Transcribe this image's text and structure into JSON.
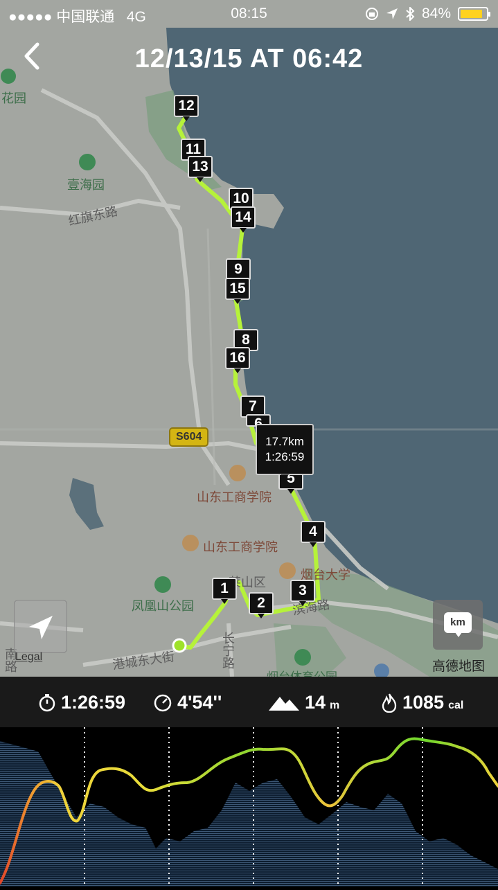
{
  "status_bar": {
    "carrier": "●●●●● 中国联通",
    "network": "4G",
    "time": "08:15",
    "battery": "84%",
    "battery_level": 0.84
  },
  "header": {
    "title": "12/13/15 AT 06:42"
  },
  "map": {
    "tooltip": {
      "distance": "17.7km",
      "time": "1:26:59"
    },
    "markers": [
      "12",
      "11",
      "13",
      "10",
      "14",
      "9",
      "15",
      "8",
      "16",
      "7",
      "6",
      "5",
      "4",
      "3",
      "2",
      "1"
    ],
    "labels": {
      "huayuan": "花园",
      "yihaiyuan": "壹海园",
      "hongqi_road": "红旗东路",
      "s604": "S604",
      "sdtbu_1": "山东工商学院",
      "sdtbu_2": "山东工商学院",
      "ytu": "烟台大学",
      "fenghuang_park": "凤凰山公园",
      "gangcheng_st": "港城东大街",
      "binhai_rd": "滨海路",
      "changning_rd": "长宁路",
      "laishan": "莱山区",
      "nan_rd": "南路",
      "sports_park": "烟台体育公园"
    },
    "legal": "Legal",
    "provider": "高德地图",
    "unit_button": "km"
  },
  "stats": {
    "duration": "1:26:59",
    "pace": "4'54''",
    "elevation": "14",
    "elevation_unit": "m",
    "calories": "1085",
    "calories_unit": "cal"
  },
  "colors": {
    "route": "#b6f23a",
    "sea": "#4e6674",
    "land": "#a3a6a1",
    "green_area": "#7fa082",
    "stats_bg": "#1a1a1a",
    "pace_fast": "#7ddb2c",
    "pace_mid": "#f0d23a",
    "pace_slow": "#e2452a"
  }
}
